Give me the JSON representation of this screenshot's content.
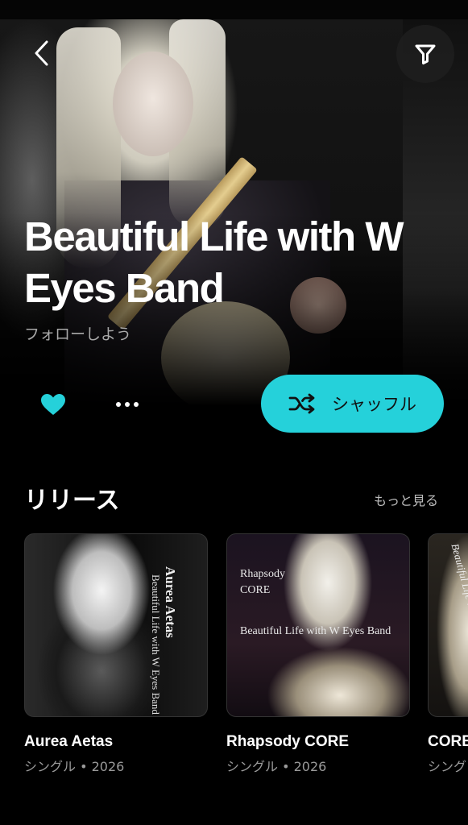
{
  "header": {
    "back_icon": "chevron-left-icon",
    "filter_icon": "filter-icon"
  },
  "artist": {
    "name": "Beautiful Life with W Eyes Band",
    "follow_text": "フォローしよう"
  },
  "actions": {
    "like_icon": "heart-icon",
    "like_color": "#25d1da",
    "more_icon": "ellipsis-icon",
    "shuffle_label": "シャッフル",
    "shuffle_icon": "shuffle-icon",
    "accent_color": "#25d1da"
  },
  "releases": {
    "section_title": "リリース",
    "more_label": "もっと見る",
    "items": [
      {
        "title": "Aurea Aetas",
        "subtitle": "シングル • 2026",
        "cover_text_title": "Aurea Aetas",
        "cover_text_artist": "Beautiful Life with W Eyes Band"
      },
      {
        "title": "Rhapsody CORE",
        "subtitle": "シングル • 2026",
        "cover_text_title": "Rhapsody\nCORE",
        "cover_text_artist": "Beautiful Life with W Eyes Band"
      },
      {
        "title": "CORE",
        "subtitle": "シング",
        "cover_text_artist": "Beautiful Life with W Eyes Band"
      }
    ]
  }
}
